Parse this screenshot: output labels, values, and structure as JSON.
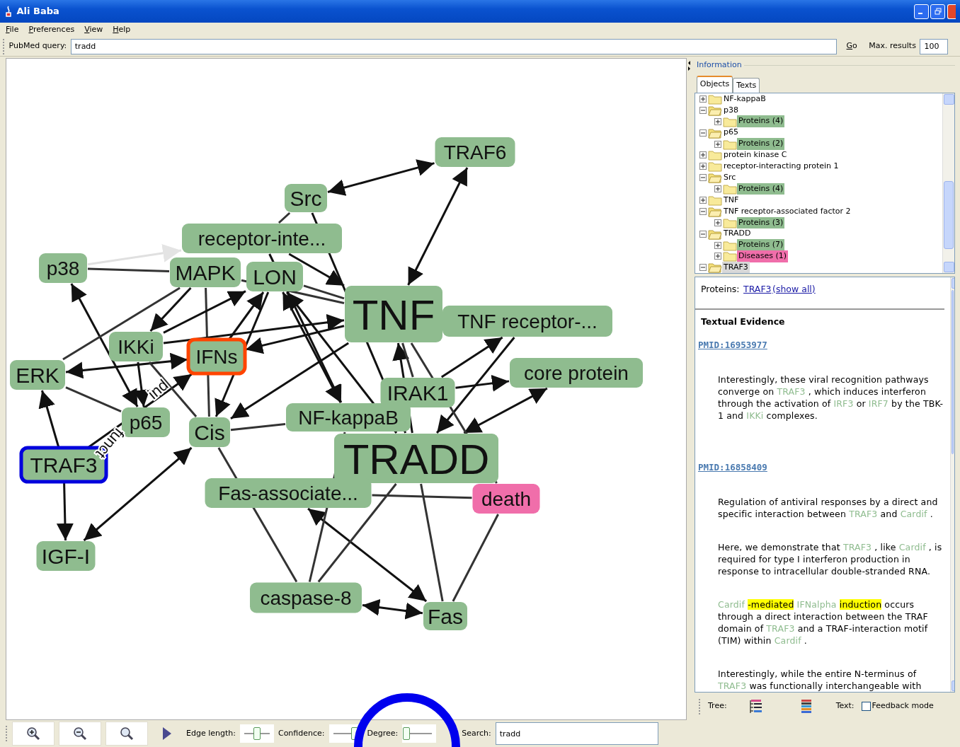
{
  "window": {
    "title": "Ali Baba"
  },
  "menu": [
    "File",
    "Preferences",
    "View",
    "Help"
  ],
  "query_bar": {
    "label": "PubMed query:",
    "value": "tradd",
    "go": "Go",
    "max_label": "Max. results",
    "max_value": "100"
  },
  "graph": {
    "nodes": [
      {
        "label": "TRAF6",
        "kind": "protein"
      },
      {
        "label": "Src",
        "kind": "protein"
      },
      {
        "label": "receptor-inte...",
        "kind": "protein"
      },
      {
        "label": "p38",
        "kind": "protein"
      },
      {
        "label": "MAPK",
        "kind": "protein"
      },
      {
        "label": "LON",
        "kind": "protein"
      },
      {
        "label": "TNF",
        "kind": "protein"
      },
      {
        "label": "TNF receptor-...",
        "kind": "protein"
      },
      {
        "label": "IKKi",
        "kind": "protein"
      },
      {
        "label": "IFNs",
        "kind": "protein",
        "color": "#ff4400"
      },
      {
        "label": "ERK",
        "kind": "protein"
      },
      {
        "label": "core protein",
        "kind": "protein"
      },
      {
        "label": "IRAK1",
        "kind": "protein"
      },
      {
        "label": "p65",
        "kind": "protein"
      },
      {
        "label": "Cis",
        "kind": "protein"
      },
      {
        "label": "NF-kappaB",
        "kind": "protein"
      },
      {
        "label": "TRAF3",
        "kind": "protein",
        "color": "#0000dd"
      },
      {
        "label": "TRADD",
        "kind": "protein"
      },
      {
        "label": "Fas-associate...",
        "kind": "protein"
      },
      {
        "label": "death",
        "kind": "disease"
      },
      {
        "label": "IGF-I",
        "kind": "protein"
      },
      {
        "label": "caspase-8",
        "kind": "protein"
      },
      {
        "label": "Fas",
        "kind": "protein"
      }
    ],
    "edge_labels": [
      "ind",
      "funct"
    ]
  },
  "graph_toolbar": {
    "edge_length": {
      "label": "Edge length:",
      "level": 0.5
    },
    "confidence": {
      "label": "Confidence:",
      "level": 0.85
    },
    "degree": {
      "label": "Degree:",
      "level": 0
    },
    "search": {
      "label": "Search:",
      "value": "tradd"
    }
  },
  "annotation": {
    "kind": "circle"
  },
  "info": {
    "title": "Information",
    "tabs": [
      {
        "label": "Objects",
        "selected": true
      },
      {
        "label": "Texts",
        "selected": false
      }
    ],
    "tree": [
      {
        "label": "NF-kappaB",
        "expanded": false,
        "selected": false
      },
      {
        "label": "p38",
        "expanded": true,
        "selected": false,
        "children": [
          {
            "label": "Proteins (4)",
            "color": "#8fbc8f",
            "expanded": false,
            "selected": false
          }
        ]
      },
      {
        "label": "p65",
        "expanded": true,
        "selected": false,
        "children": [
          {
            "label": "Proteins (2)",
            "color": "#8fbc8f",
            "expanded": false,
            "selected": false
          }
        ]
      },
      {
        "label": "protein kinase C",
        "expanded": false,
        "selected": false
      },
      {
        "label": "receptor-interacting protein 1",
        "expanded": false,
        "selected": false
      },
      {
        "label": "Src",
        "expanded": true,
        "selected": false,
        "children": [
          {
            "label": "Proteins (4)",
            "color": "#8fbc8f",
            "expanded": false,
            "selected": false
          }
        ]
      },
      {
        "label": "TNF",
        "expanded": false,
        "selected": false
      },
      {
        "label": "TNF receptor-associated factor 2",
        "expanded": true,
        "selected": false,
        "children": [
          {
            "label": "Proteins (3)",
            "color": "#8fbc8f",
            "expanded": false,
            "selected": false
          }
        ]
      },
      {
        "label": "TRADD",
        "expanded": true,
        "selected": false,
        "children": [
          {
            "label": "Proteins (7)",
            "color": "#8fbc8f",
            "expanded": false,
            "selected": false
          },
          {
            "label": "Diseases (1)",
            "color": "#f06eaa",
            "expanded": false,
            "selected": false
          }
        ]
      },
      {
        "label": "TRAF3",
        "expanded": true,
        "selected": true
      }
    ],
    "proteins_label": "Proteins:",
    "proteins_links": [
      "TRAF3",
      "(show all)"
    ],
    "evidence_title": "Textual Evidence",
    "evidence": [
      {
        "pmid": "PMID:16953977",
        "paragraphs": [
          [
            {
              "text": "Interestingly, these viral recognition pathways converge on ",
              "kind": "plain"
            },
            {
              "text": "TRAF3",
              "kind": "entity"
            },
            {
              "text": " , which induces interferon through the activation of ",
              "kind": "plain"
            },
            {
              "text": "IRF3",
              "kind": "entity"
            },
            {
              "text": " or ",
              "kind": "plain"
            },
            {
              "text": "IRF7",
              "kind": "entity"
            },
            {
              "text": " by the TBK-1 and ",
              "kind": "plain"
            },
            {
              "text": "IKKi",
              "kind": "entity"
            },
            {
              "text": " complexes.",
              "kind": "plain"
            }
          ]
        ]
      },
      {
        "pmid": "PMID:16858409",
        "paragraphs": [
          [
            {
              "text": "Regulation of antiviral responses by a direct and specific interaction between ",
              "kind": "plain"
            },
            {
              "text": "TRAF3",
              "kind": "entity"
            },
            {
              "text": " and ",
              "kind": "plain"
            },
            {
              "text": "Cardif",
              "kind": "entity"
            },
            {
              "text": " .",
              "kind": "plain"
            }
          ],
          [
            {
              "text": "Here, we demonstrate that ",
              "kind": "plain"
            },
            {
              "text": "TRAF3",
              "kind": "entity"
            },
            {
              "text": " , like ",
              "kind": "plain"
            },
            {
              "text": "Cardif",
              "kind": "entity"
            },
            {
              "text": " , is required for type I interferon production in response to intracellular double-stranded RNA.",
              "kind": "plain"
            }
          ],
          [
            {
              "text": "Cardif ",
              "kind": "entity"
            },
            {
              "text": "-mediated",
              "kind": "trigger"
            },
            {
              "text": " IFNalpha ",
              "kind": "entity"
            },
            {
              "text": "induction",
              "kind": "trigger"
            },
            {
              "text": " occurs through a direct interaction between the TRAF domain of ",
              "kind": "plain"
            },
            {
              "text": "TRAF3",
              "kind": "entity"
            },
            {
              "text": " and a TRAF-interaction motif (TIM) within ",
              "kind": "plain"
            },
            {
              "text": "Cardif",
              "kind": "entity"
            },
            {
              "text": " .",
              "kind": "plain"
            }
          ],
          [
            {
              "text": "Interestingly, while the entire N-terminus of ",
              "kind": "plain"
            },
            {
              "text": "TRAF3",
              "kind": "entity"
            },
            {
              "text": " was functionally interchangeable with",
              "kind": "plain"
            }
          ]
        ]
      }
    ],
    "footer": {
      "tree_label": "Tree:",
      "text_label": "Text:",
      "feedback": {
        "label": "Feedback mode",
        "checked": false
      }
    }
  }
}
